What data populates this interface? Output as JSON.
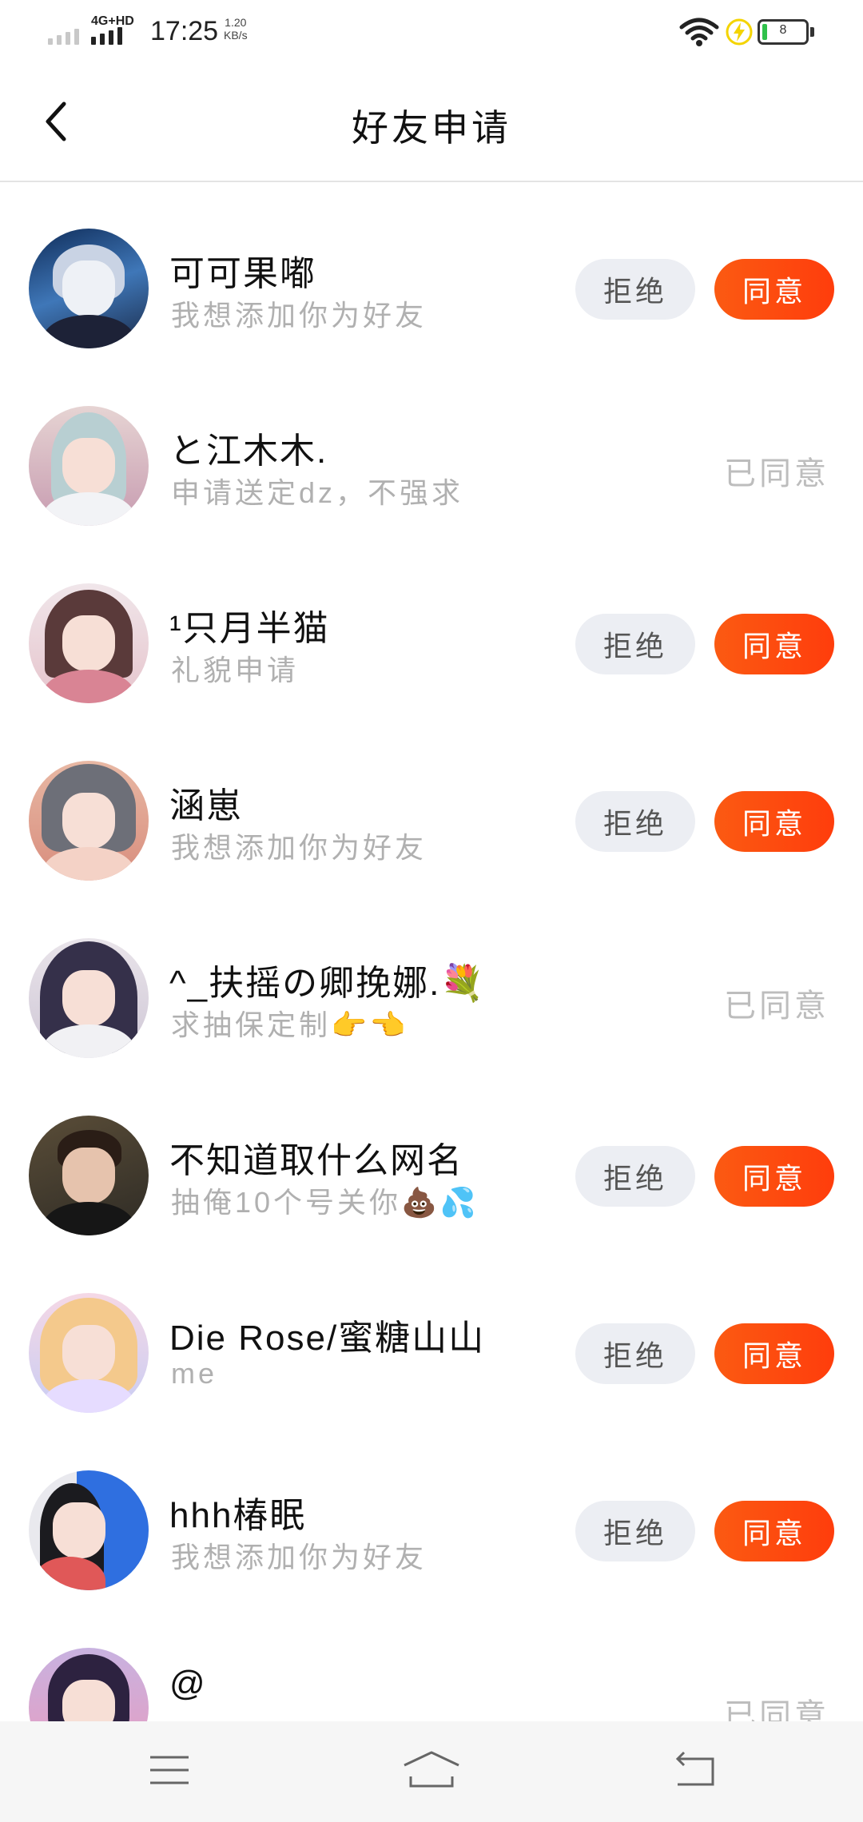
{
  "status_bar": {
    "network": "4G+HD",
    "time": "17:25",
    "speed_value": "1.20",
    "speed_unit": "KB/s",
    "battery": "8",
    "battery_color": "#2fc14b",
    "charging_color": "#f4d400"
  },
  "header": {
    "title": "好友申请",
    "back_icon": "chevron-left-icon"
  },
  "colors": {
    "accept_bg": "#ff4a10",
    "reject_bg": "#eceef3",
    "muted_text": "#b0b0b0"
  },
  "requests": [
    {
      "name": "可可果嘟",
      "message": "我想添加你为好友",
      "status": "pending",
      "reject_label": "拒绝",
      "accept_label": "同意"
    },
    {
      "name": "と江木木.",
      "message": "申请送定dz，不强求",
      "status": "agreed",
      "status_label": "已同意"
    },
    {
      "name": "¹只月半猫",
      "message": "礼貌申请",
      "status": "pending",
      "reject_label": "拒绝",
      "accept_label": "同意"
    },
    {
      "name": "涵崽",
      "message": "我想添加你为好友",
      "status": "pending",
      "reject_label": "拒绝",
      "accept_label": "同意"
    },
    {
      "name": "^_扶摇の卿挽娜.💐",
      "message": "求抽保定制👉👈",
      "status": "agreed",
      "status_label": "已同意"
    },
    {
      "name": "不知道取什么网名",
      "message": "抽俺10个号关你💩💦",
      "status": "pending",
      "reject_label": "拒绝",
      "accept_label": "同意"
    },
    {
      "name": "Die Rose/蜜糖山山",
      "message": "me",
      "status": "pending",
      "reject_label": "拒绝",
      "accept_label": "同意"
    },
    {
      "name": "hhh椿眠",
      "message": "我想添加你为好友",
      "status": "pending",
      "reject_label": "拒绝",
      "accept_label": "同意"
    },
    {
      "name": "@",
      "message": "",
      "status": "agreed",
      "status_label": "已同意"
    }
  ],
  "navbar": {
    "menu_icon": "menu-icon",
    "home_icon": "home-icon",
    "back_icon": "back-arrow-icon"
  }
}
